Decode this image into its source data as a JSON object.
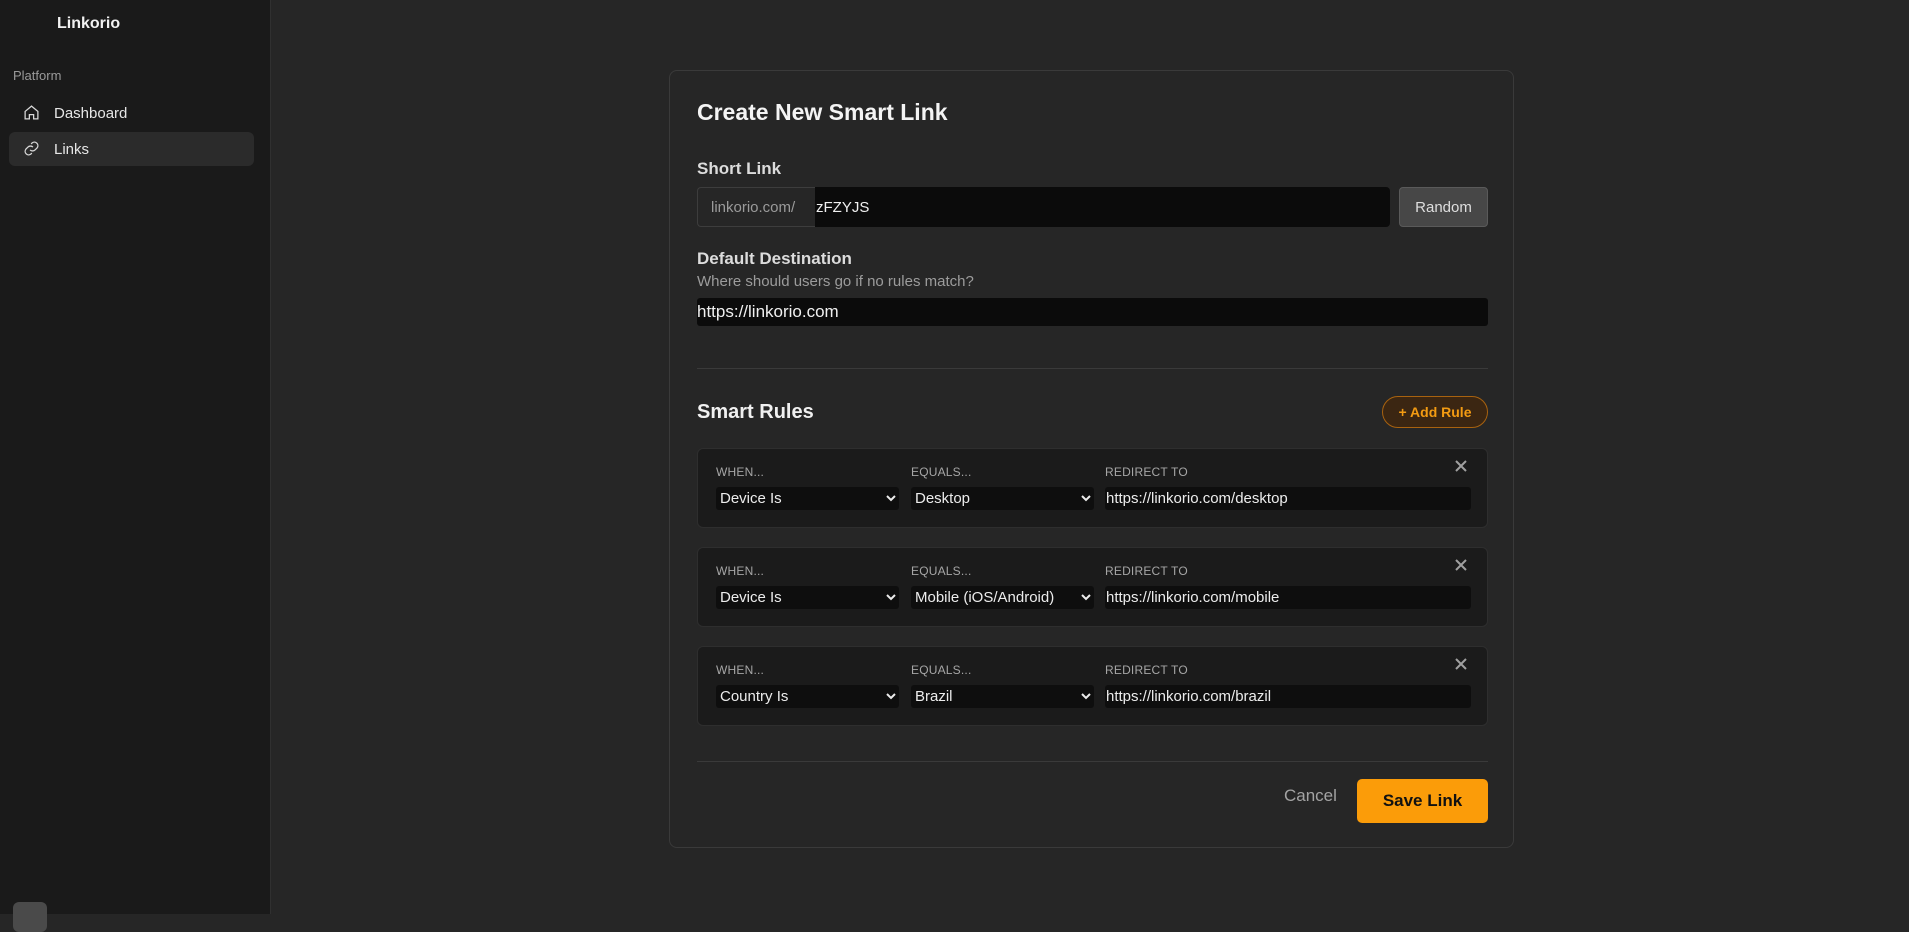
{
  "sidebar": {
    "brand": "Linkorio",
    "section_label": "Platform",
    "items": [
      {
        "label": "Dashboard",
        "icon": "home-icon",
        "active": false
      },
      {
        "label": "Links",
        "icon": "link-icon",
        "active": true
      }
    ]
  },
  "form": {
    "title": "Create New Smart Link",
    "short_link": {
      "label": "Short Link",
      "prefix": "linkorio.com/",
      "value": "zFZYJS",
      "random_label": "Random"
    },
    "default_destination": {
      "label": "Default Destination",
      "helper": "Where should users go if no rules match?",
      "value": "https://linkorio.com"
    },
    "smart_rules": {
      "title": "Smart Rules",
      "add_label": "+ Add Rule",
      "when_label": "WHEN...",
      "equals_label": "EQUALS...",
      "redirect_label": "REDIRECT TO",
      "rules": [
        {
          "when": "Device Is",
          "equals": "Desktop",
          "redirect": "https://linkorio.com/desktop"
        },
        {
          "when": "Device Is",
          "equals": "Mobile (iOS/Android)",
          "redirect": "https://linkorio.com/mobile"
        },
        {
          "when": "Country Is",
          "equals": "Brazil",
          "redirect": "https://linkorio.com/brazil"
        }
      ]
    },
    "cancel_label": "Cancel",
    "save_label": "Save Link"
  },
  "colors": {
    "accent": "#fb9c09",
    "background": "#262626",
    "sidebar": "#1a1a1a"
  }
}
